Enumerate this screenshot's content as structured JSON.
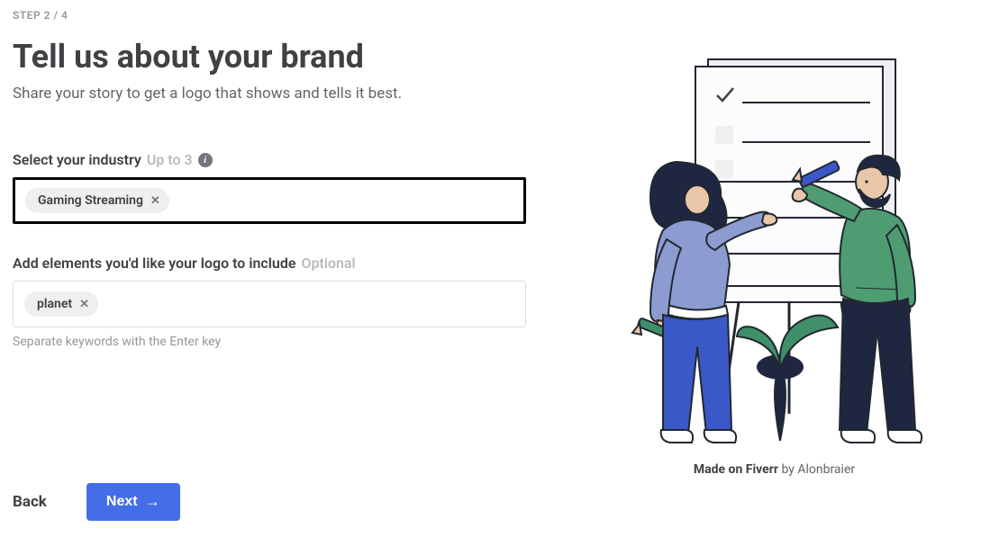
{
  "step": "STEP 2 / 4",
  "heading": "Tell us about your brand",
  "subtitle": "Share your story to get a logo that shows and tells it best.",
  "industry": {
    "label": "Select your industry",
    "hint": "Up to 3",
    "chips": [
      "Gaming Streaming"
    ]
  },
  "elements": {
    "label": "Add elements you'd like your logo to include",
    "hint": "Optional",
    "chips": [
      "planet"
    ],
    "helper": "Separate keywords with the Enter key"
  },
  "footer": {
    "back": "Back",
    "next": "Next"
  },
  "illustration": {
    "caption_strong": "Made on Fiverr",
    "caption_rest": " by Alonbraier"
  }
}
